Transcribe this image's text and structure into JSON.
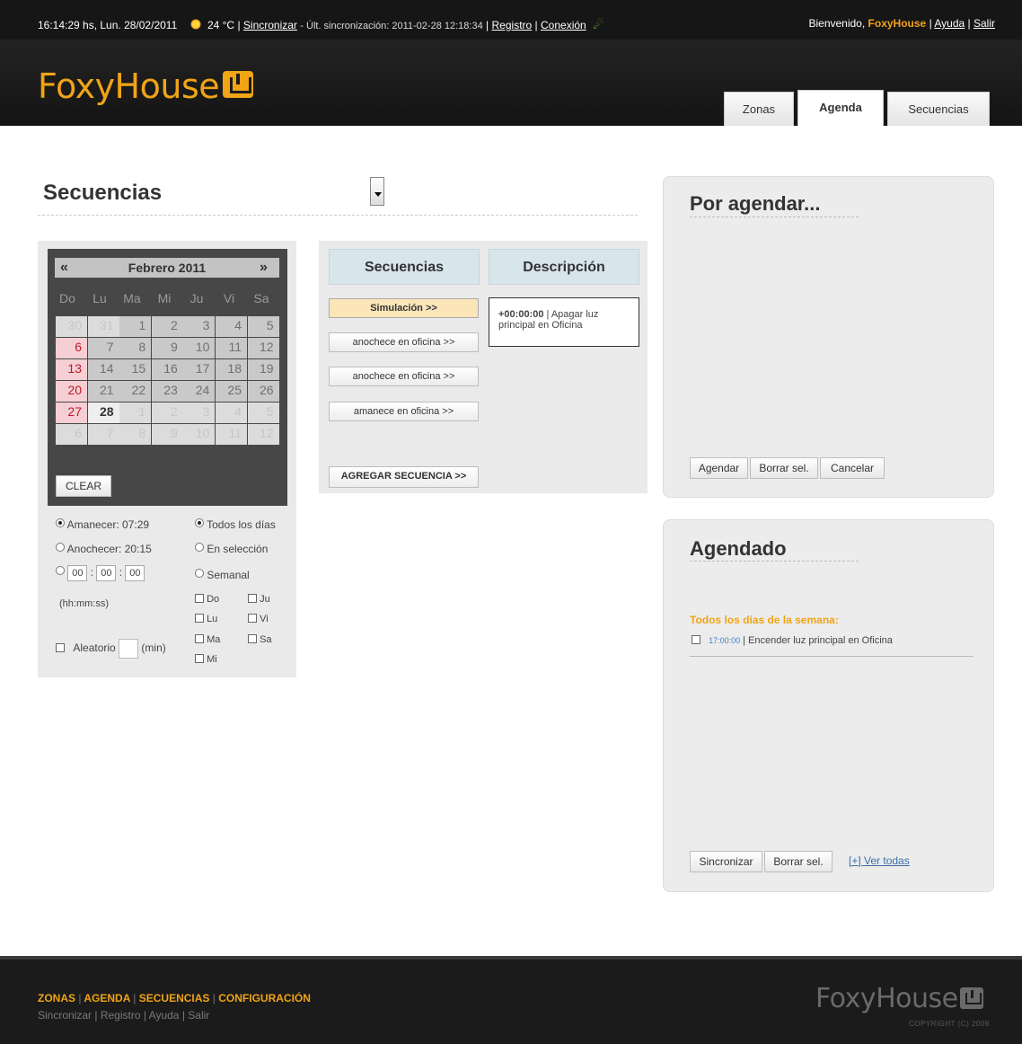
{
  "topbar": {
    "datetime": "16:14:29 hs, Lun. 28/02/2011",
    "temperature": "24 °C",
    "sync_link": "Sincronizar",
    "last_sync": "- Últ. sincronización: 2011-02-28 12:18:34",
    "registro": "Registro",
    "conexion": "Conexión",
    "welcome": "Bienvenido,",
    "user": "FoxyHouse",
    "ayuda": "Ayuda",
    "salir": "Salir",
    "sep": "|"
  },
  "header": {
    "logo_text": "FoxyHouse",
    "tabs": [
      {
        "label": "Zonas"
      },
      {
        "label": "Agenda"
      },
      {
        "label": "Secuencias"
      }
    ]
  },
  "section": {
    "selected": "Secuencias"
  },
  "calendar": {
    "month": "Febrero 2011",
    "prev": "«",
    "next": "»",
    "dow": [
      "Do",
      "Lu",
      "Ma",
      "Mi",
      "Ju",
      "Vi",
      "Sa"
    ],
    "weeks": [
      [
        "30",
        "31",
        "1",
        "2",
        "3",
        "4",
        "5"
      ],
      [
        "6",
        "7",
        "8",
        "9",
        "10",
        "11",
        "12"
      ],
      [
        "13",
        "14",
        "15",
        "16",
        "17",
        "18",
        "19"
      ],
      [
        "20",
        "21",
        "22",
        "23",
        "24",
        "25",
        "26"
      ],
      [
        "27",
        "28",
        "1",
        "2",
        "3",
        "4",
        "5"
      ],
      [
        "6",
        "7",
        "8",
        "9",
        "10",
        "11",
        "12"
      ]
    ],
    "clear": "CLEAR"
  },
  "options": {
    "amanecer": "Amanecer: 07:29",
    "anochecer": "Anochecer: 20:15",
    "time": [
      "00",
      "00",
      "00"
    ],
    "time_sep": ":",
    "time_hint": "(hh:mm:ss)",
    "aleatorio": "Aleatorio",
    "min": "(min)",
    "todos": "Todos los días",
    "seleccion": "En selección",
    "semanal": "Semanal",
    "days": [
      "Do",
      "Ju",
      "Lu",
      "Vi",
      "Ma",
      "Sa",
      "Mi"
    ]
  },
  "sequences": {
    "col_sequences": "Secuencias",
    "col_description": "Descripción",
    "items": [
      {
        "label": "Simulación >>"
      },
      {
        "label": "anochece en oficina >>"
      },
      {
        "label": "anochece en oficina >>"
      },
      {
        "label": "amanece en oficina >>"
      }
    ],
    "add": "AGREGAR SECUENCIA >>",
    "desc_time": "+00:00:00",
    "desc_text": "| Apagar luz principal en Oficina"
  },
  "por_agendar": {
    "title": "Por agendar...",
    "agendar": "Agendar",
    "borrar": "Borrar sel.",
    "cancelar": "Cancelar"
  },
  "agendado": {
    "title": "Agendado",
    "group": "Todos los días de la semana:",
    "item_time": "17:00:00",
    "item_text": "| Encender luz principal en Oficina",
    "sincronizar": "Sincronizar",
    "borrar": "Borrar sel.",
    "ver_todas": "[+] Ver todas"
  },
  "footer": {
    "nav": [
      "ZONAS",
      "AGENDA",
      "SECUENCIAS",
      "CONFIGURACIÓN"
    ],
    "sub": [
      "Sincronizar",
      "Registro",
      "Ayuda",
      "Salir"
    ],
    "sep": "|",
    "logo": "FoxyHouse",
    "copyright": "COPYRIGHT (C) 2009"
  },
  "colors": {
    "accent": "#f0a416",
    "active_sequence": "#fbe5b9",
    "column_header": "#d8e6ec",
    "sunday": "#c0182c"
  }
}
